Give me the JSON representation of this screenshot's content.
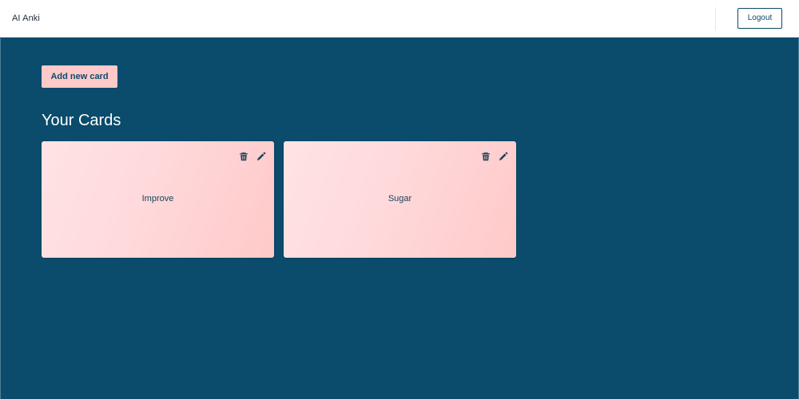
{
  "header": {
    "app_title": "AI Anki",
    "logout_label": "Logout"
  },
  "main": {
    "add_card_label": "Add new card",
    "section_title": "Your Cards",
    "cards": [
      {
        "word": "Improve"
      },
      {
        "word": "Sugar"
      }
    ]
  },
  "colors": {
    "background": "#0b4b6b",
    "card_pink": "#ffc9c9",
    "text_navy": "#18425b",
    "white": "#ffffff"
  },
  "icons": {
    "delete": "trash-icon",
    "edit": "pencil-icon"
  }
}
